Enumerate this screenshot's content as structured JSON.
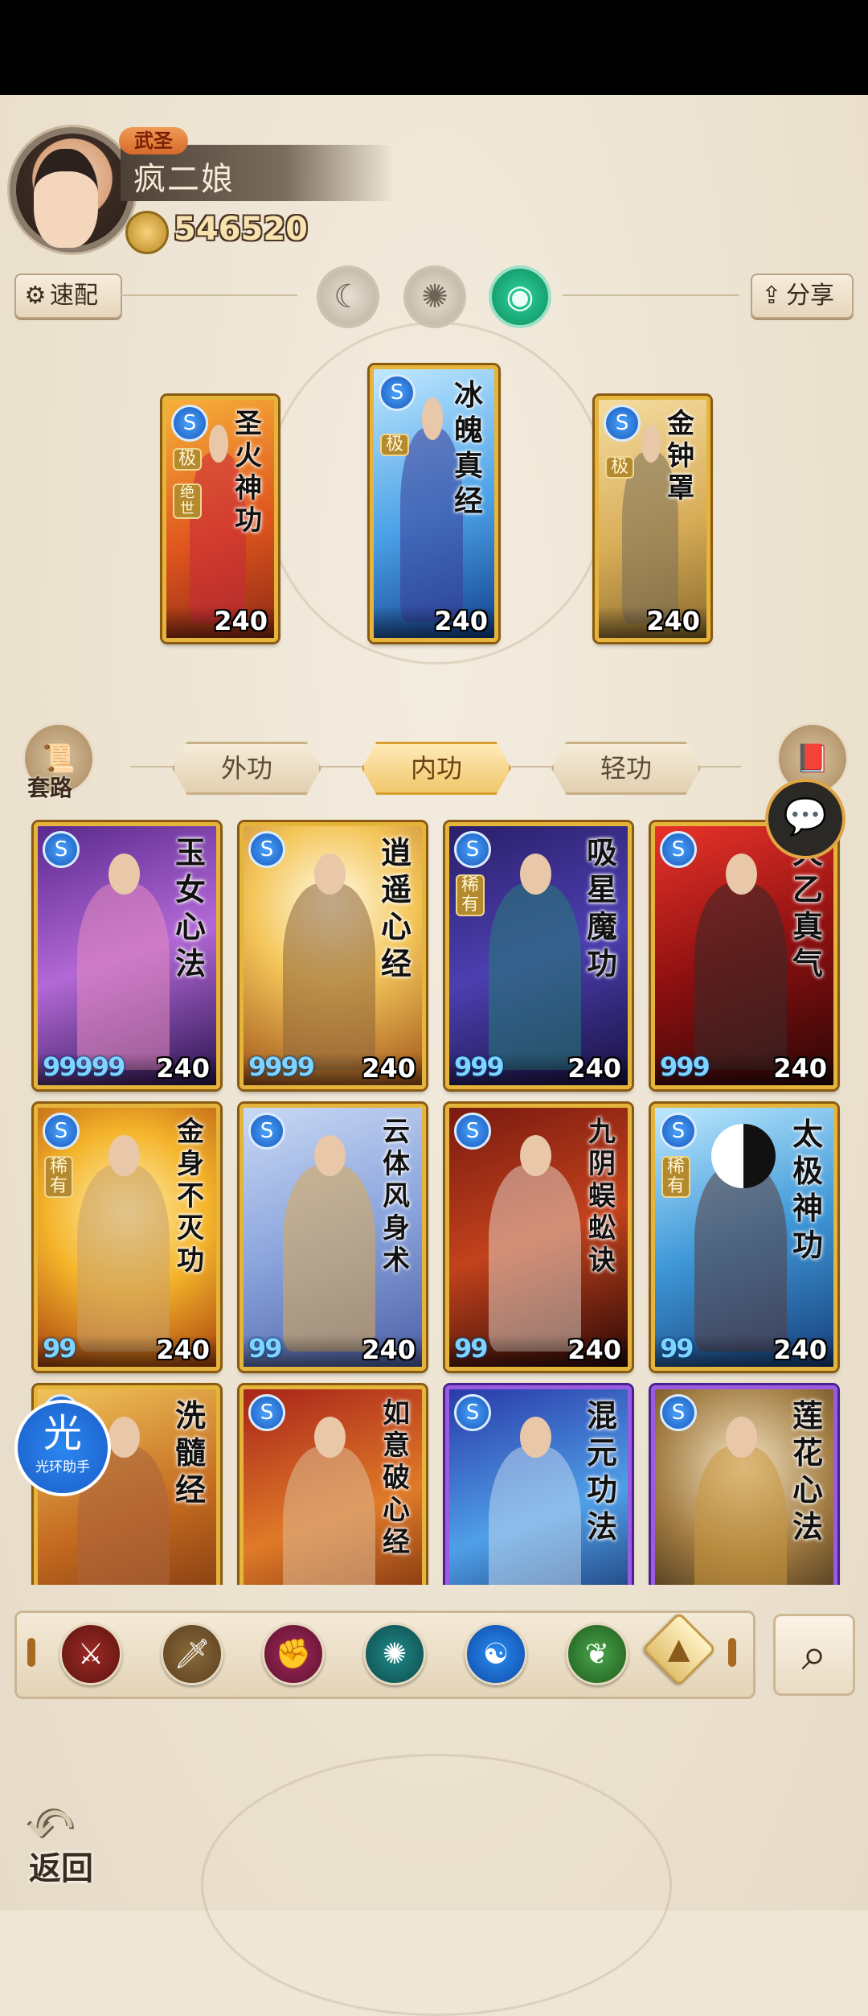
{
  "profile": {
    "title_badge": "武圣",
    "name": "疯二娘",
    "power": "546520"
  },
  "header": {
    "quick_label": "速配",
    "share_label": "分享"
  },
  "equipped": [
    {
      "name": "圣火神功",
      "level": "240",
      "tags": [
        "极",
        "绝世"
      ]
    },
    {
      "name": "冰魄真经",
      "level": "240",
      "tags": [
        "极"
      ]
    },
    {
      "name": "金钟罩",
      "level": "240",
      "tags": [
        "极"
      ]
    }
  ],
  "tabs": {
    "left_label": "套路",
    "items": [
      "外功",
      "内功",
      "轻功"
    ],
    "active": "内功",
    "right_label": "秘籍"
  },
  "skills": [
    {
      "name": "玉女心法",
      "pips": "99999",
      "level": "240",
      "rare": ""
    },
    {
      "name": "逍遥心经",
      "pips": "9999",
      "level": "240",
      "rare": ""
    },
    {
      "name": "吸星魔功",
      "pips": "999",
      "level": "240",
      "rare": "稀有"
    },
    {
      "name": "天乙真气",
      "pips": "999",
      "level": "240",
      "rare": ""
    },
    {
      "name": "金身不灭功",
      "pips": "99",
      "level": "240",
      "rare": "稀有"
    },
    {
      "name": "云体风身术",
      "pips": "99",
      "level": "240",
      "rare": ""
    },
    {
      "name": "九阴蜈蚣诀",
      "pips": "99",
      "level": "240",
      "rare": ""
    },
    {
      "name": "太极神功",
      "pips": "99",
      "level": "240",
      "rare": "稀有"
    },
    {
      "name": "洗髓经",
      "pips": "",
      "level": "",
      "rare": ""
    },
    {
      "name": "如意破心经",
      "pips": "",
      "level": "",
      "rare": ""
    },
    {
      "name": "混元功法",
      "pips": "",
      "level": "",
      "rare": ""
    },
    {
      "name": "莲花心法",
      "pips": "",
      "level": "",
      "rare": ""
    }
  ],
  "helper": {
    "big": "光",
    "small": "光环助手"
  },
  "filters": [
    "blade",
    "sword",
    "fist",
    "fan",
    "taiji",
    "snake",
    "all"
  ],
  "back_label": "返回",
  "colors": {
    "gold_frame": "#e4b53a",
    "purple_frame": "#9b5be0",
    "active_tab": "#f0c76b"
  }
}
